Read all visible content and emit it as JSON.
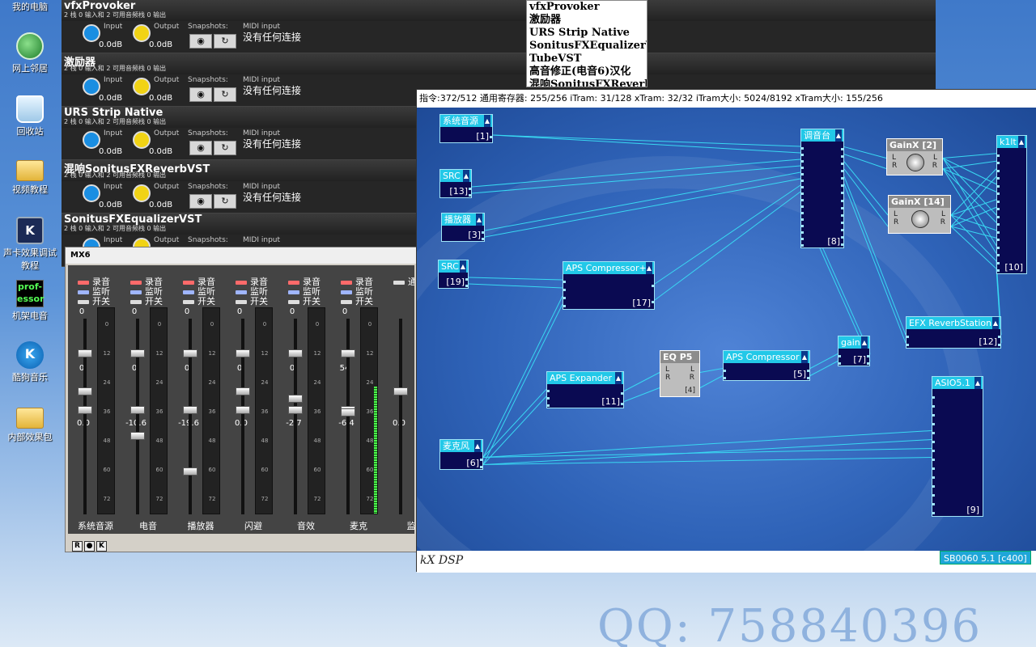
{
  "desktop": {
    "icons": [
      {
        "name": "我的电脑",
        "icon": "computer-icon"
      },
      {
        "name": "网上邻居",
        "icon": "network-icon"
      },
      {
        "name": "回收站",
        "icon": "recycle-bin-icon"
      },
      {
        "name": "视频教程",
        "icon": "folder-icon"
      },
      {
        "name": "声卡效果调试教程",
        "icon": "kx-icon"
      },
      {
        "name": "机架电音",
        "icon": "professor-icon"
      },
      {
        "name": "酷狗音乐",
        "icon": "kugou-icon"
      },
      {
        "name": "内部效果包",
        "icon": "folder-icon"
      }
    ],
    "professor_logo_text": "prof-essor",
    "kugou_logo_letter": "K",
    "watermark": "QQ: 758840396"
  },
  "rack": {
    "input_label": "Input",
    "output_label": "Output",
    "snapshots_label": "Snapshots:",
    "midi_label": "MIDI input",
    "plugins": [
      {
        "name": "vfxProvoker",
        "sub": "2 栈 0 输入和 2 可用音频栈 0 输出",
        "input_db": "0.0dB",
        "output_db": "0.0dB",
        "midi": "没有任何连接"
      },
      {
        "name": "激励器",
        "sub": "2 栈 0 输入和 2 可用音频栈 0 输出",
        "input_db": "0.0dB",
        "output_db": "0.0dB",
        "midi": "没有任何连接"
      },
      {
        "name": "URS Strip Native",
        "sub": "2 栈 0 输入和 2 可用音频栈 0 输出",
        "input_db": "0.0dB",
        "output_db": "0.0dB",
        "midi": "没有任何连接"
      },
      {
        "name": "混响SonitusFXReverbVST",
        "sub": "2 栈 0 输入和 2 可用音频栈 0 输出",
        "input_db": "0.0dB",
        "output_db": "0.0dB",
        "midi": "没有任何连接"
      },
      {
        "name": "SonitusFXEqualizerVST",
        "sub": "2 栈 0 输入和 2 可用音频栈 0 输出",
        "input_db": "",
        "output_db": "",
        "midi": ""
      }
    ]
  },
  "plugin_list": [
    "vfxProvoker",
    "激励器",
    "URS Strip Native",
    "SonitusFXEqualizerVST",
    "TubeVST",
    "高音修正(电音6)汉化",
    "混响SonitusFXReverb"
  ],
  "mixer": {
    "title": "MX6",
    "switch_labels": {
      "rec": "录音",
      "mon": "监听",
      "on": "开关"
    },
    "strips": [
      {
        "label": "系统音源",
        "top": "0",
        "mid": "0",
        "db": "0.0",
        "fader": 0.37,
        "level": 0
      },
      {
        "label": "电音",
        "top": "0",
        "mid": "0",
        "db": "-10.6",
        "fader": 0.6,
        "level": 0
      },
      {
        "label": "播放器",
        "top": "0",
        "mid": "0",
        "db": "-19.6",
        "fader": 0.78,
        "level": 0
      },
      {
        "label": "闪避",
        "top": "0",
        "mid": "0",
        "db": "0.0",
        "fader": 0.37,
        "level": 0
      },
      {
        "label": "音效",
        "top": "0",
        "mid": "0",
        "db": "-2.7",
        "fader": 0.41,
        "level": 0
      },
      {
        "label": "麦克",
        "top": "0",
        "mid": "54",
        "db": "-6.4",
        "fader": 0.48,
        "level": 0.62
      },
      {
        "label": "监",
        "top": "",
        "mid": "",
        "db": "0.0",
        "fader": 0.37,
        "level": 0
      }
    ],
    "partial_switch_label": "通",
    "meter_ticks": [
      "0",
      "12",
      "24",
      "36",
      "48",
      "60",
      "72"
    ],
    "footer_buttons": [
      "R",
      "●",
      "K"
    ]
  },
  "dsp": {
    "status": "指令:372/512 通用寄存器: 255/256 iTram: 31/128 xTram: 32/32 iTram大小: 5024/8192 xTram大小: 155/256",
    "logo": "kX DSP",
    "device": "SB0060 5.1 [c400]",
    "blocks": {
      "sys": {
        "name": "系统音源",
        "id": "[1]"
      },
      "src13": {
        "name": "SRC",
        "id": "[13]"
      },
      "player": {
        "name": "播放器",
        "id": "[3]"
      },
      "src19": {
        "name": "SRC",
        "id": "[19]"
      },
      "mic": {
        "name": "麦克风",
        "id": "[6]"
      },
      "aps_comp17": {
        "name": "APS Compressor+",
        "id": "[17]"
      },
      "aps_exp": {
        "name": "APS Expander",
        "id": "[11]"
      },
      "eq": {
        "name": "EQ P5",
        "id": "[4]",
        "l": "L",
        "r": "R"
      },
      "aps_comp5": {
        "name": "APS Compressor",
        "id": "[5]"
      },
      "gain": {
        "name": "gain",
        "id": "[7]"
      },
      "mixer8": {
        "name": "调音台",
        "id": "[8]"
      },
      "gainx2": {
        "name": "GainX [2]",
        "l": "L",
        "r": "R"
      },
      "gainx14": {
        "name": "GainX [14]",
        "l": "L",
        "r": "R"
      },
      "k1lt": {
        "name": "k1lt",
        "id": "[10]"
      },
      "efx": {
        "name": "EFX ReverbStation",
        "id": "[12]"
      },
      "asio": {
        "name": "ASIO5.1",
        "id": "[9]"
      }
    }
  }
}
